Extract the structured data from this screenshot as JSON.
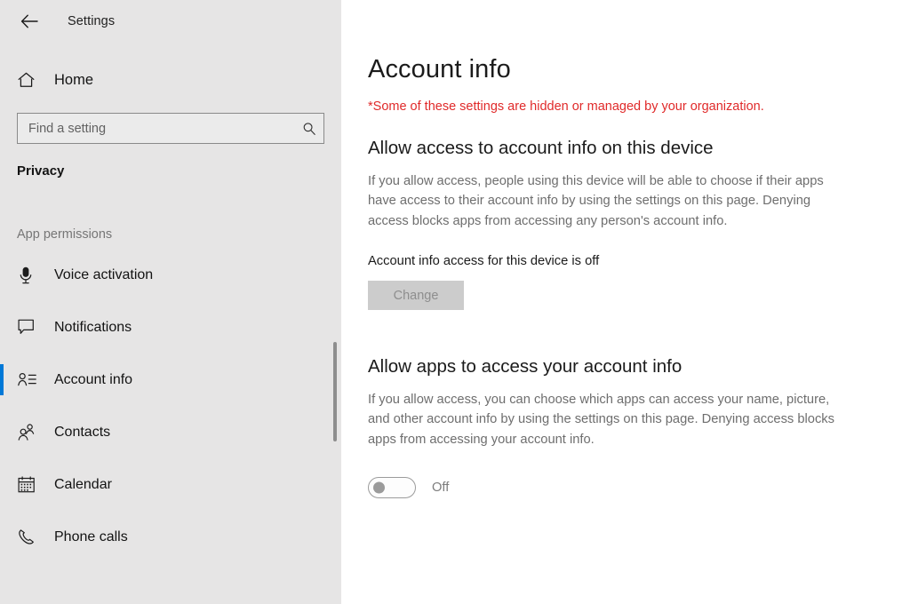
{
  "window": {
    "app_title": "Settings",
    "back_icon": "back-arrow-icon"
  },
  "sidebar": {
    "home": {
      "label": "Home",
      "icon": "home-icon"
    },
    "search": {
      "placeholder": "Find a setting",
      "value": "",
      "icon": "search-icon"
    },
    "section_title": "Privacy",
    "group_label": "App permissions",
    "items": [
      {
        "label": "Voice activation",
        "icon": "microphone-icon",
        "selected": false
      },
      {
        "label": "Notifications",
        "icon": "speech-bubble-icon",
        "selected": false
      },
      {
        "label": "Account info",
        "icon": "contact-card-icon",
        "selected": true
      },
      {
        "label": "Contacts",
        "icon": "people-icon",
        "selected": false
      },
      {
        "label": "Calendar",
        "icon": "calendar-icon",
        "selected": false
      },
      {
        "label": "Phone calls",
        "icon": "phone-handset-icon",
        "selected": false
      }
    ],
    "accent_color": "#0078d7",
    "background_color": "#e6e5e5"
  },
  "main": {
    "page_title": "Account info",
    "org_note": "*Some of these settings are hidden or managed by your organization.",
    "org_note_color": "#e02a2a",
    "device_section": {
      "heading": "Allow access to account info on this device",
      "description": "If you allow access, people using this device will be able to choose if their apps have access to their account info by using the settings on this page. Denying access blocks apps from accessing any person's account info.",
      "status": "Account info access for this device is off",
      "change_button": "Change",
      "change_button_disabled": true
    },
    "apps_section": {
      "heading": "Allow apps to access your account info",
      "description": "If you allow access, you can choose which apps can access your name, picture, and other account info by using the settings on this page. Denying access blocks apps from accessing your account info.",
      "toggle_state": "Off",
      "toggle_on": false
    }
  }
}
